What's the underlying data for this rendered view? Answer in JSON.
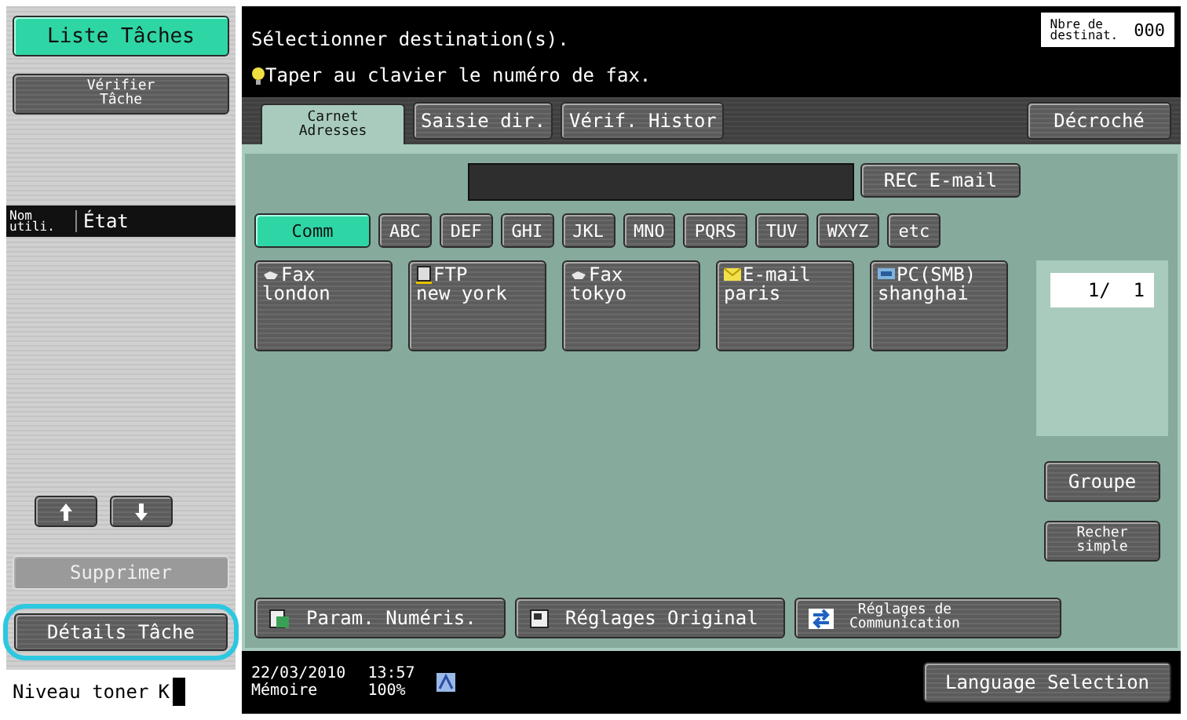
{
  "sidebar": {
    "job_list_button": {
      "label": "Liste Tâches",
      "selected": true
    },
    "check_job_button": {
      "label": "Vérifier\nTâche"
    },
    "columns": [
      {
        "label": "Nom\nutili."
      },
      {
        "label": "État"
      }
    ],
    "delete_button": {
      "label": "Supprimer",
      "disabled": true
    },
    "details_button": {
      "label": "Détails Tâche",
      "highlighted": true
    },
    "toner": {
      "label": "Niveau toner",
      "color_label": "K",
      "level": 1
    }
  },
  "header": {
    "title": "Sélectionner destination(s).",
    "hint": "Taper au clavier le numéro de fax.",
    "counter_label": "Nbre de\ndestinat.",
    "counter_value": "000"
  },
  "tabs": [
    {
      "label": "Carnet\nAdresses",
      "selected": true
    },
    {
      "label": "Saisie dir.",
      "selected": false
    },
    {
      "label": "Vérif. Histor",
      "selected": false
    }
  ],
  "off_hook_button": {
    "label": "Décroché"
  },
  "rec_email_button": {
    "label": "REC E-mail"
  },
  "index_buttons": [
    {
      "label": "Comm",
      "selected": true
    },
    {
      "label": "ABC",
      "selected": false
    },
    {
      "label": "DEF",
      "selected": false
    },
    {
      "label": "GHI",
      "selected": false
    },
    {
      "label": "JKL",
      "selected": false
    },
    {
      "label": "MNO",
      "selected": false
    },
    {
      "label": "PQRS",
      "selected": false
    },
    {
      "label": "TUV",
      "selected": false
    },
    {
      "label": "WXYZ",
      "selected": false
    },
    {
      "label": "etc",
      "selected": false
    }
  ],
  "destinations": [
    {
      "kind": "fax",
      "type_label": "Fax",
      "name": "london"
    },
    {
      "kind": "ftp",
      "type_label": "FTP",
      "name": "new york"
    },
    {
      "kind": "fax",
      "type_label": "Fax",
      "name": "tokyo"
    },
    {
      "kind": "email",
      "type_label": "E-mail",
      "name": "paris"
    },
    {
      "kind": "smb",
      "type_label": "PC(SMB)",
      "name": "shanghai"
    }
  ],
  "page_indicator": "1/  1",
  "group_button": {
    "label": "Groupe"
  },
  "simple_search_button": {
    "label": "Recher\nsimple"
  },
  "settings_buttons": [
    {
      "kind": "scan",
      "label": "Param. Numéris."
    },
    {
      "kind": "original",
      "label": "Réglages Original"
    },
    {
      "kind": "comm",
      "label": "Réglages de\nCommunication"
    }
  ],
  "status_bar": {
    "date": "22/03/2010",
    "time": "13:57",
    "memory_label": "Mémoire",
    "memory_value": "100%",
    "language_button": "Language Selection"
  }
}
